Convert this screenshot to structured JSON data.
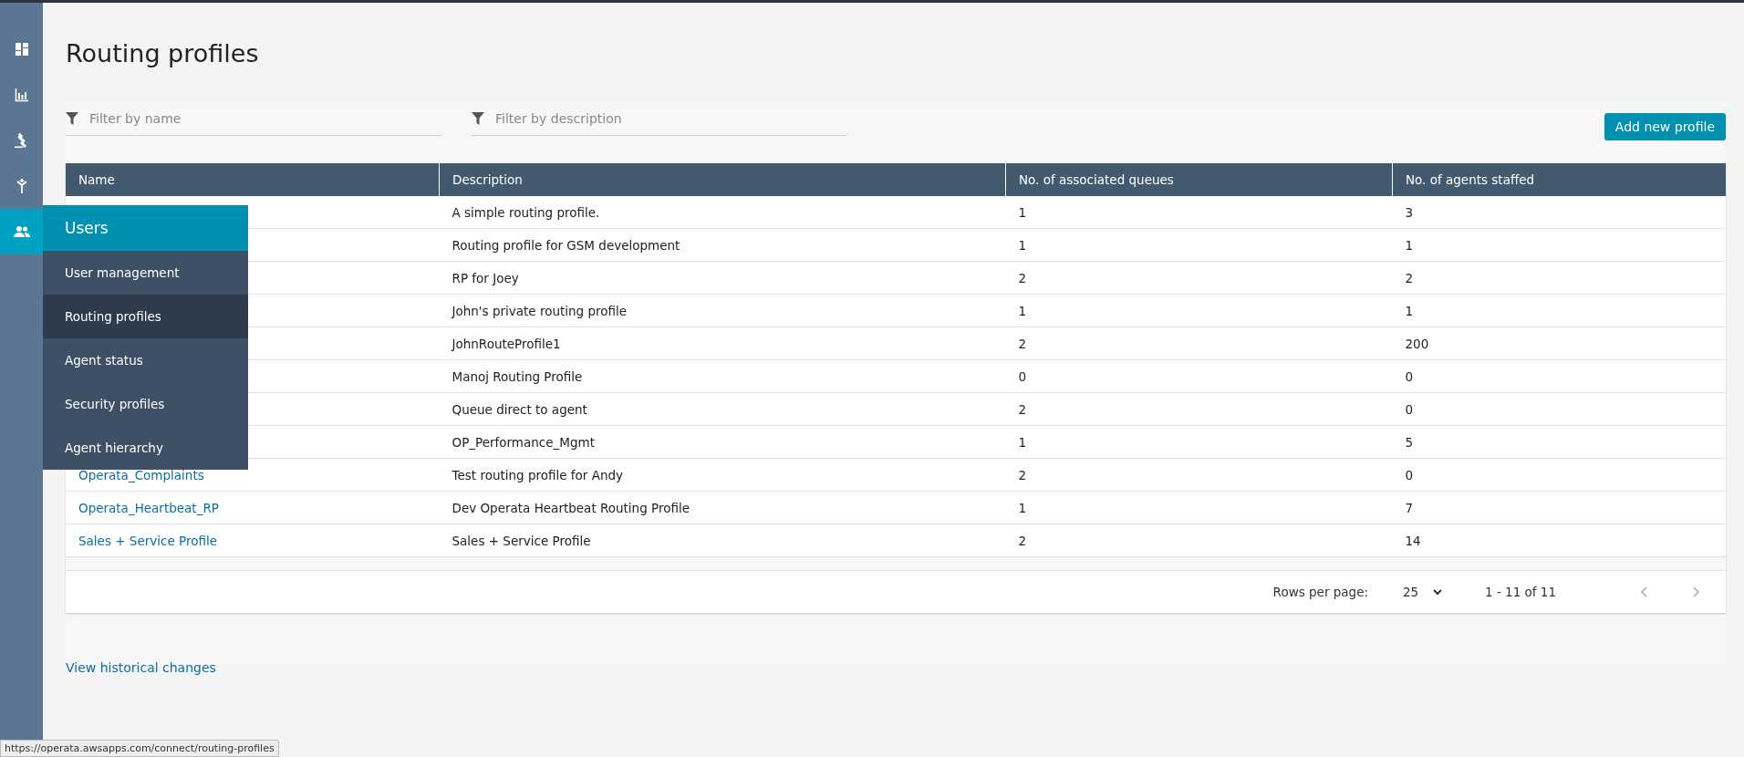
{
  "page": {
    "title": "Routing profiles"
  },
  "filters": [
    {
      "placeholder": "Filter by name"
    },
    {
      "placeholder": "Filter by description"
    }
  ],
  "add_button": "Add new profile",
  "table": {
    "columns": [
      "Name",
      "Description",
      "No. of associated queues",
      "No. of agents staffed"
    ],
    "rows": [
      {
        "description": "A simple routing profile.",
        "queues": "1",
        "agents": "3"
      },
      {
        "description": "Routing profile for GSM development",
        "queues": "1",
        "agents": "1"
      },
      {
        "description": "RP for Joey",
        "queues": "2",
        "agents": "2"
      },
      {
        "description": "John's private routing profile",
        "queues": "1",
        "agents": "1"
      },
      {
        "description": "JohnRouteProfile1",
        "queues": "2",
        "agents": "200"
      },
      {
        "description": "Manoj Routing Profile",
        "queues": "0",
        "agents": "0"
      },
      {
        "description": "Queue direct to agent",
        "queues": "2",
        "agents": "0"
      },
      {
        "description": "OP_Performance_Mgmt",
        "queues": "1",
        "agents": "5"
      },
      {
        "name": "Operata_Complaints",
        "description": "Test routing profile for Andy",
        "queues": "2",
        "agents": "0"
      },
      {
        "name": "Operata_Heartbeat_RP",
        "description": "Dev Operata Heartbeat Routing Profile",
        "queues": "1",
        "agents": "7"
      },
      {
        "name": "Sales + Service Profile",
        "description": "Sales + Service Profile",
        "queues": "2",
        "agents": "14"
      }
    ]
  },
  "pagination": {
    "rows_label": "Rows per page:",
    "rows_value": "25",
    "range": "1 - 11 of 11"
  },
  "history_link": "View historical changes",
  "sidebar": {
    "items": [
      {
        "kind": "dashboard",
        "selected": false
      },
      {
        "kind": "metrics",
        "selected": false
      },
      {
        "kind": "gavel",
        "selected": false
      },
      {
        "kind": "routing",
        "selected": false
      },
      {
        "kind": "users",
        "selected": true
      }
    ]
  },
  "menu": {
    "title": "Users",
    "items": [
      {
        "label": "User management",
        "selected": false
      },
      {
        "label": "Routing profiles",
        "selected": true
      },
      {
        "label": "Agent status",
        "selected": false
      },
      {
        "label": "Security profiles",
        "selected": false
      },
      {
        "label": "Agent hierarchy",
        "selected": false
      }
    ]
  },
  "status_url": "https://operata.awsapps.com/connect/routing-profiles"
}
